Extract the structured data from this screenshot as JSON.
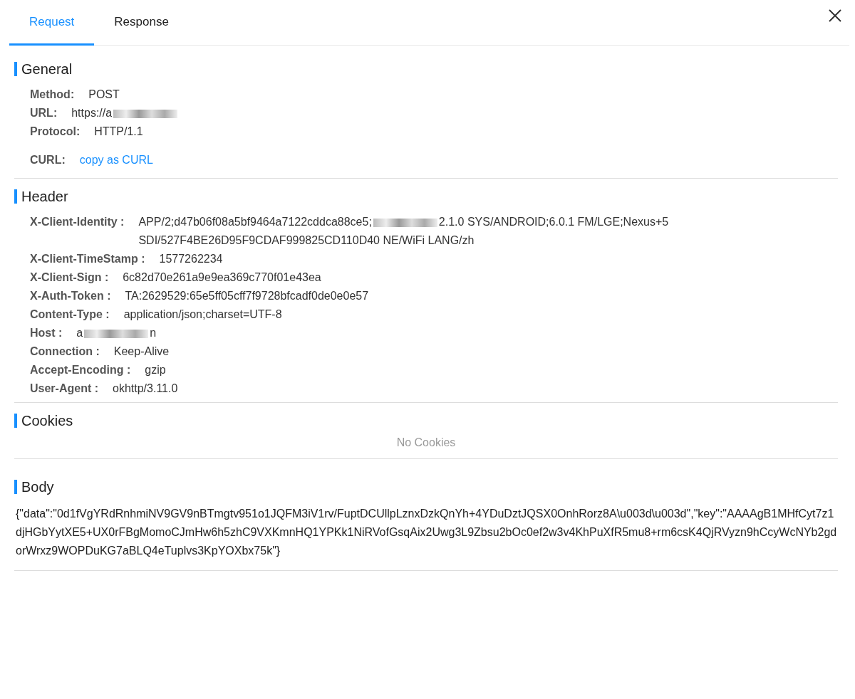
{
  "tabs": [
    {
      "label": "Request",
      "selected": true
    },
    {
      "label": "Response",
      "selected": false
    }
  ],
  "general": {
    "title": "General",
    "fields": [
      {
        "label": "Method:",
        "parts": [
          {
            "kind": "text",
            "text": "POST"
          }
        ]
      },
      {
        "label": "URL:",
        "parts": [
          {
            "kind": "text",
            "text": "https://a"
          },
          {
            "kind": "redacted"
          }
        ]
      },
      {
        "label": "Protocol:",
        "parts": [
          {
            "kind": "text",
            "text": "HTTP/1.1"
          }
        ]
      }
    ],
    "curl": {
      "label": "CURL:",
      "link": "copy as CURL"
    }
  },
  "header": {
    "title": "Header",
    "fields": [
      {
        "label": "X-Client-Identity :",
        "parts": [
          {
            "kind": "text",
            "text": "APP/2;d47b06f08a5bf9464a7122cddca88ce5;"
          },
          {
            "kind": "redacted"
          },
          {
            "kind": "text",
            "text": "2.1.0 SYS/ANDROID;6.0.1 FM/LGE;Nexus+5 SDI/527F4BE26D95F9CDAF999825CD110D40 NE/WiFi LANG/zh"
          }
        ]
      },
      {
        "label": "X-Client-TimeStamp :",
        "parts": [
          {
            "kind": "text",
            "text": "1577262234"
          }
        ]
      },
      {
        "label": "X-Client-Sign :",
        "parts": [
          {
            "kind": "text",
            "text": "6c82d70e261a9e9ea369c770f01e43ea"
          }
        ]
      },
      {
        "label": "X-Auth-Token :",
        "parts": [
          {
            "kind": "text",
            "text": "TA:2629529:65e5ff05cff7f9728bfcadf0de0e0e57"
          }
        ]
      },
      {
        "label": "Content-Type :",
        "parts": [
          {
            "kind": "text",
            "text": "application/json;charset=UTF-8"
          }
        ]
      },
      {
        "label": "Host :",
        "parts": [
          {
            "kind": "text",
            "text": "a"
          },
          {
            "kind": "redacted"
          },
          {
            "kind": "text",
            "text": "n"
          }
        ]
      },
      {
        "label": "Connection :",
        "parts": [
          {
            "kind": "text",
            "text": "Keep-Alive"
          }
        ]
      },
      {
        "label": "Accept-Encoding :",
        "parts": [
          {
            "kind": "text",
            "text": "gzip"
          }
        ]
      },
      {
        "label": "User-Agent :",
        "parts": [
          {
            "kind": "text",
            "text": "okhttp/3.11.0"
          }
        ]
      }
    ]
  },
  "cookies": {
    "title": "Cookies",
    "empty_text": "No Cookies"
  },
  "body": {
    "title": "Body",
    "text": "{\"data\":\"0d1fVgYRdRnhmiNV9GV9nBTmgtv951o1JQFM3iV1rv/FuptDCUllpLznxDzkQnYh+4YDuDztJQSX0OnhRorz8A\\u003d\\u003d\",\"key\":\"AAAAgB1MHfCyt7z1djHGbYytXE5+UX0rFBgMomoCJmHw6h5zhC9VXKmnHQ1YPKk1NiRVofGsqAix2Uwg3L9Zbsu2bOc0ef2w3v4KhPuXfR5mu8+rm6csK4QjRVyzn9hCcyWcNYb2gdorWrxz9WOPDuKG7aBLQ4eTuplvs3KpYOXbx75k\"}"
  }
}
